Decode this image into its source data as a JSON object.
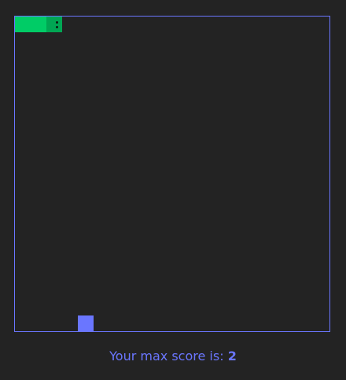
{
  "game": {
    "cells": 20,
    "snake": {
      "body": [
        {
          "col": 0,
          "row": 0
        },
        {
          "col": 1,
          "row": 0
        }
      ],
      "head": {
        "col": 2,
        "row": 0
      },
      "direction": "right",
      "color": "#00cc66",
      "head_color": "#00a653"
    },
    "food": {
      "col": 4,
      "row": 19,
      "color": "#6a76ff"
    },
    "border_color": "#6a76ff",
    "background_color": "#232323"
  },
  "score": {
    "label": "Your max score is: ",
    "value": "2"
  }
}
